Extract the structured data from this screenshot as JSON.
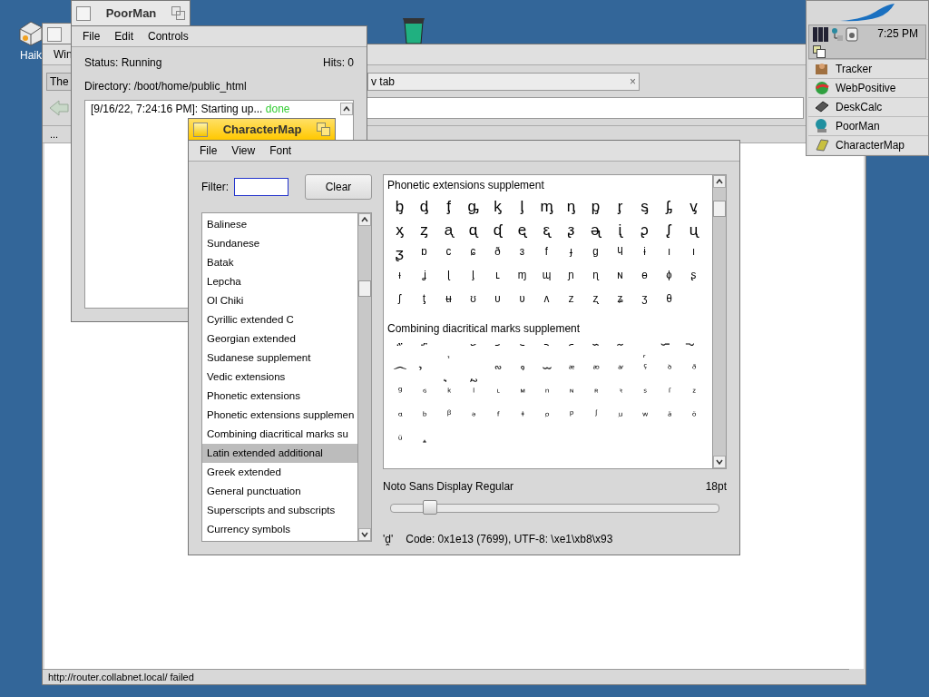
{
  "desktop": {
    "icons": [
      {
        "kind": "disk",
        "label": "Haik"
      },
      {
        "kind": "trash"
      }
    ]
  },
  "deskbar": {
    "clock": "7:25 PM",
    "apps": [
      {
        "kind": "tracker",
        "label": "Tracker"
      },
      {
        "kind": "web",
        "label": "WebPositive"
      },
      {
        "kind": "calc",
        "label": "DeskCalc"
      },
      {
        "kind": "server",
        "label": "PoorMan"
      },
      {
        "kind": "charmap",
        "label": "CharacterMap"
      }
    ]
  },
  "browser": {
    "menu": [
      "Win"
    ],
    "tabs": [
      {
        "label": "The",
        "selected": false
      },
      {
        "label": "v tab",
        "selected": true,
        "close": "×"
      }
    ],
    "bookmark_row": "...",
    "status": "http://router.collabnet.local/ failed"
  },
  "poorman": {
    "title": "PoorMan",
    "menu": [
      "File",
      "Edit",
      "Controls"
    ],
    "status": "Status: Running",
    "hits": "Hits: 0",
    "directory": "Directory: /boot/home/public_html",
    "log": [
      {
        "text": "[9/16/22, 7:24:16 PM]: Starting up...",
        "result": "done"
      }
    ]
  },
  "charmap": {
    "title": "CharacterMap",
    "menu": [
      "File",
      "View",
      "Font"
    ],
    "filter": {
      "label": "Filter:"
    },
    "clear_button": "Clear",
    "blocks": [
      {
        "label": "Balinese",
        "selected": false
      },
      {
        "label": "Sundanese",
        "selected": false
      },
      {
        "label": "Batak",
        "selected": false
      },
      {
        "label": "Lepcha",
        "selected": false
      },
      {
        "label": "Ol Chiki",
        "selected": false
      },
      {
        "label": "Cyrillic extended C",
        "selected": false
      },
      {
        "label": "Georgian extended",
        "selected": false
      },
      {
        "label": "Sudanese supplement",
        "selected": false
      },
      {
        "label": "Vedic extensions",
        "selected": false
      },
      {
        "label": "Phonetic extensions",
        "selected": false
      },
      {
        "label": "Phonetic extensions supplemen",
        "selected": false
      },
      {
        "label": "Combining diacritical marks su",
        "selected": false
      },
      {
        "label": "Latin extended additional",
        "selected": true
      },
      {
        "label": "Greek extended",
        "selected": false
      },
      {
        "label": "General punctuation",
        "selected": false
      },
      {
        "label": "Superscripts and subscripts",
        "selected": false
      },
      {
        "label": "Currency symbols",
        "selected": false
      }
    ],
    "sections": [
      {
        "title": "Phonetic extensions supplement",
        "glyphs": [
          "ᶀ",
          "ᶁ",
          "ᶂ",
          "ᶃ",
          "ᶄ",
          "ᶅ",
          "ᶆ",
          "ᶇ",
          "ᶈ",
          "ᶉ",
          "ᶊ",
          "ᶋ",
          "ᶌ",
          "ᶍ",
          "ᶎ",
          "ᶏ",
          "ᶐ",
          "ᶑ",
          "ᶒ",
          "ᶓ",
          "ᶔ",
          "ᶕ",
          "ᶖ",
          "ᶗ",
          "ᶘ",
          "ᶙ",
          "ᶚ",
          "ᶛ",
          "ᶜ",
          "ᶝ",
          "ᶞ",
          "ᶟ",
          "ᶠ",
          "ᶡ",
          "ᶢ",
          "ᶣ",
          "ᶤ",
          "ᶥ",
          "ᶦ",
          "ᶧ",
          "ᶨ",
          "ᶩ",
          "ᶪ",
          "ᶫ",
          "ᶬ",
          "ᶭ",
          "ᶮ",
          "ᶯ",
          "ᶰ",
          "ᶱ",
          "ᶲ",
          "ᶳ",
          "ᶴ",
          "ᶵ",
          "ᶶ",
          "ᶷ",
          "ᶸ",
          "ᶹ",
          "ᶺ",
          "ᶻ",
          "ᶼ",
          "ᶽ",
          "ᶾ",
          "ᶿ"
        ]
      },
      {
        "title": "Combining diacritical marks supplement",
        "glyphs": [
          "᷀",
          "᷁",
          "᷂",
          "᷃",
          "᷄",
          "᷅",
          "᷆",
          "᷇",
          "᷈",
          "᷉",
          "᷊",
          "᷋",
          "᷌",
          "᷍",
          "᷎",
          "᷏",
          "᷐",
          "᷑",
          "᷒",
          "ᷓ",
          "ᷔ",
          "ᷕ",
          "ᷖ",
          "ᷗ",
          "ᷘ",
          "ᷙ",
          "ᷚ",
          "ᷛ",
          "ᷜ",
          "ᷝ",
          "ᷞ",
          "ᷟ",
          "ᷠ",
          "ᷡ",
          "ᷢ",
          "ᷣ",
          "ᷤ",
          "ᷥ",
          "ᷦ",
          "ᷧ",
          "ᷨ",
          "ᷩ",
          "ᷪ",
          "ᷫ",
          "ᷬ",
          "ᷭ",
          "ᷮ",
          "ᷯ",
          "ᷰ",
          "ᷱ",
          "ᷲ",
          "ᷳ",
          "ᷴ",
          "᷵"
        ]
      }
    ],
    "font": "Noto Sans Display Regular",
    "size": "18pt",
    "size_slider": {
      "level": 0.12
    },
    "selected_char": "'ḓ'",
    "code": "Code: 0x1e13 (7699), UTF-8: \\xe1\\xb8\\x93"
  }
}
